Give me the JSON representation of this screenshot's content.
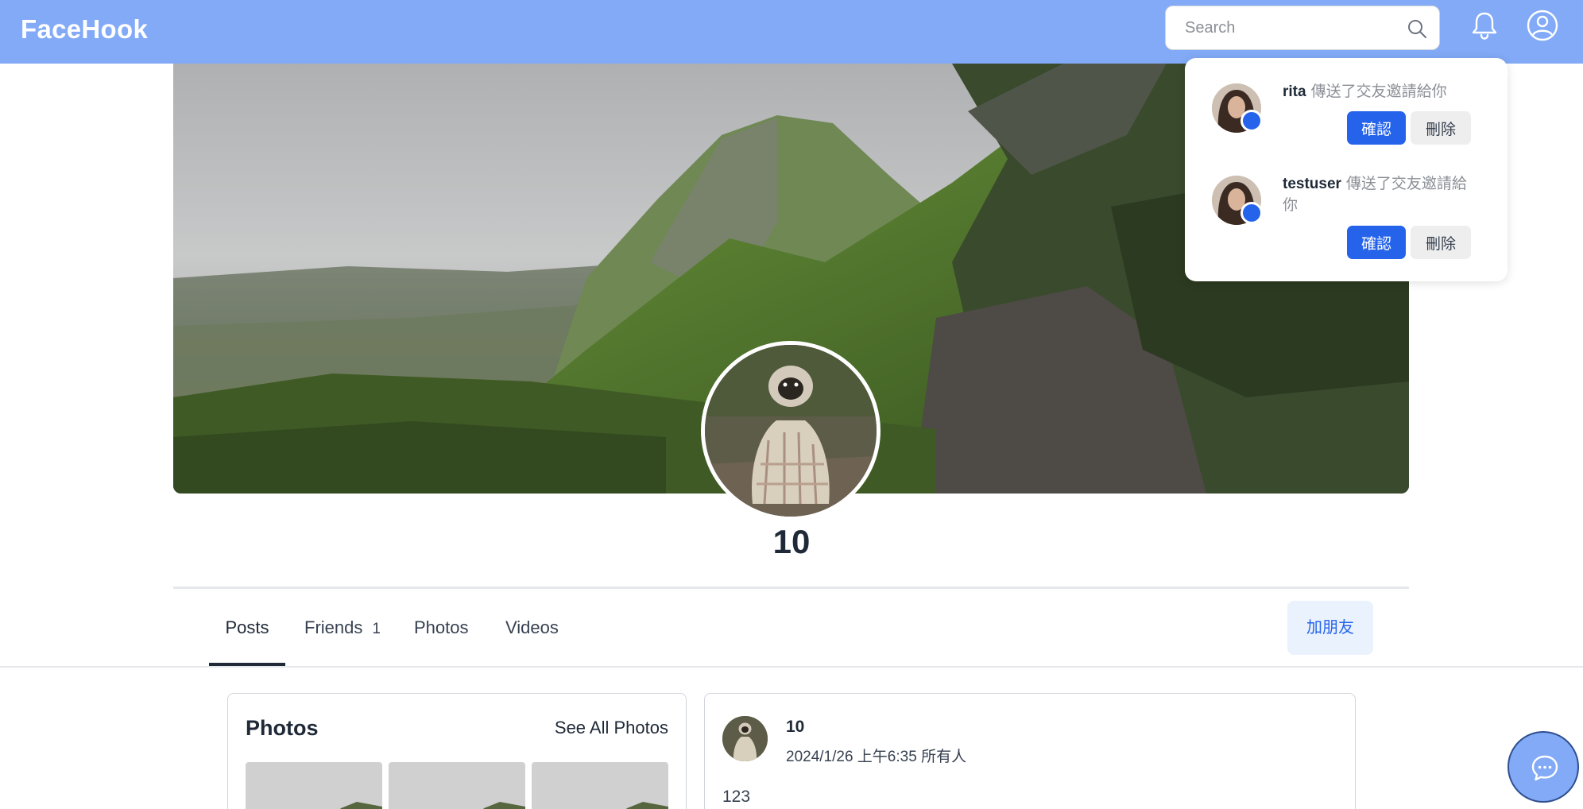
{
  "app": {
    "brand": "FaceHook"
  },
  "header": {
    "search_placeholder": "Search"
  },
  "profile": {
    "name": "10"
  },
  "tabs": [
    {
      "label": "Posts",
      "active": true
    },
    {
      "label": "Friends",
      "count": "1"
    },
    {
      "label": "Photos"
    },
    {
      "label": "Videos"
    }
  ],
  "actions": {
    "add_friend": "加朋友"
  },
  "photos_card": {
    "title": "Photos",
    "see_all": "See All Photos"
  },
  "post": {
    "author": "10",
    "timestamp": "2024/1/26 上午6:35",
    "visibility": "所有人",
    "text": "123"
  },
  "notifications": {
    "items": [
      {
        "user": "rita",
        "message": "傳送了交友邀請給你",
        "confirm": "確認",
        "delete": "刪除"
      },
      {
        "user": "testuser",
        "message": "傳送了交友邀請給你",
        "confirm": "確認",
        "delete": "刪除"
      }
    ]
  },
  "colors": {
    "nav": "#82aaf6",
    "primary": "#2563eb",
    "add_friend_bg": "#eaf2fd"
  },
  "icons": [
    "search-icon",
    "bell-icon",
    "user-circle-icon",
    "chat-bubble-icon",
    "friend-request-badge-icon"
  ]
}
